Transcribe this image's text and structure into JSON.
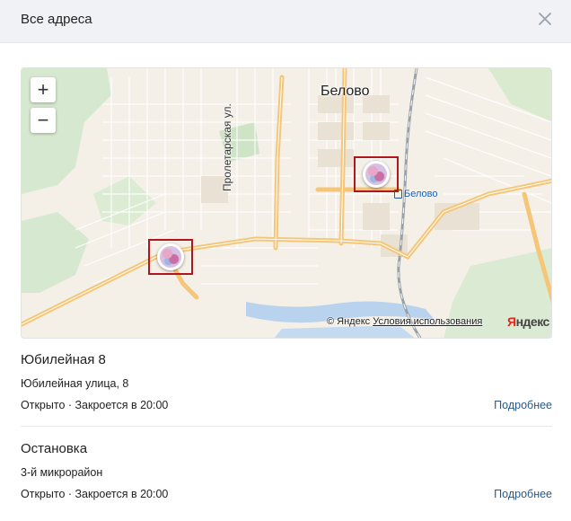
{
  "header": {
    "title": "Все адреса"
  },
  "map": {
    "zoom_in": "+",
    "zoom_out": "−",
    "city_label": "Белово",
    "street_label": "Пролетарская ул.",
    "station_label": "Белово",
    "attribution": {
      "copyright": "© Яндекс",
      "terms": "Условия использования",
      "logo_first": "Я",
      "logo_rest": "ндекс"
    }
  },
  "addresses": [
    {
      "name": "Юбилейная 8",
      "address": "Юбилейная улица, 8",
      "status": "Открыто · Закроется в 20:00",
      "more": "Подробнее"
    },
    {
      "name": "Остановка",
      "address": "3-й микрорайон",
      "status": "Открыто · Закроется в 20:00",
      "more": "Подробнее"
    }
  ],
  "colors": {
    "accent_link": "#2a5885",
    "pin_frame": "#b0161e",
    "road": "#f5c678"
  }
}
